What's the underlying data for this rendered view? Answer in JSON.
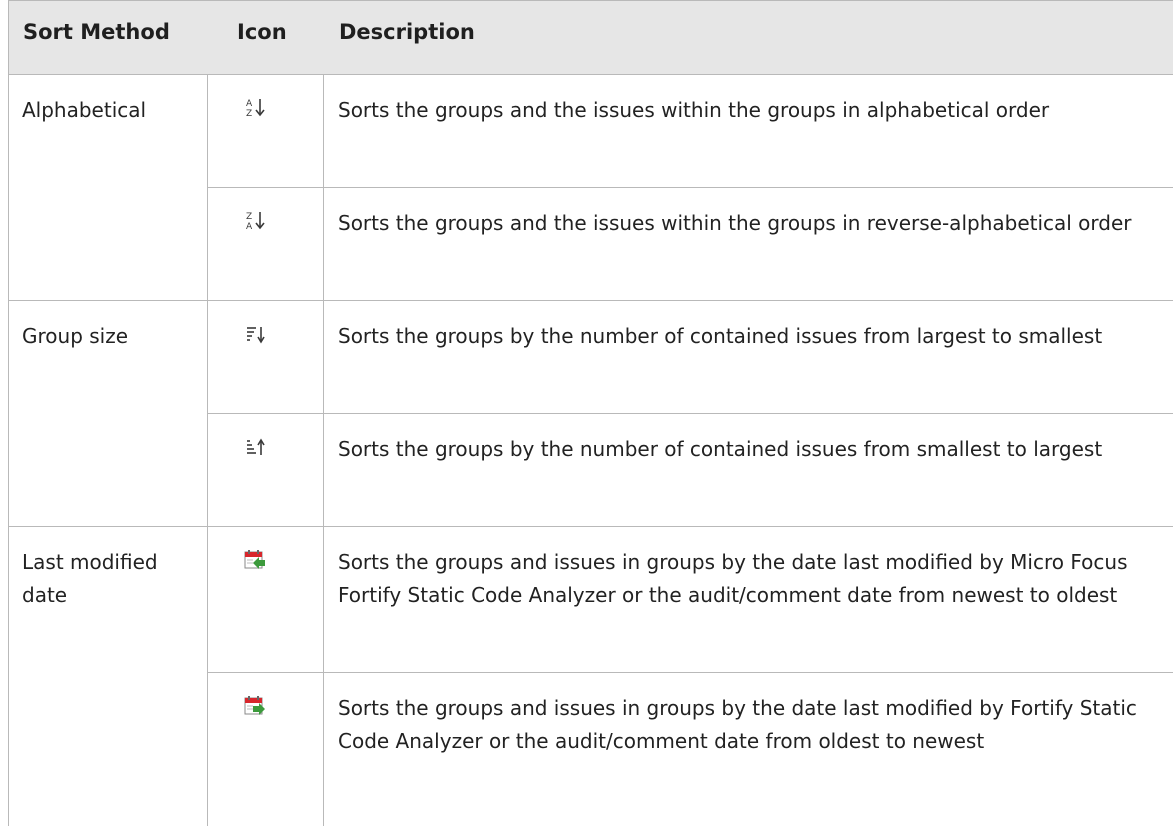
{
  "table": {
    "headers": {
      "method": "Sort Method",
      "icon": "Icon",
      "description": "Description"
    },
    "groups": [
      {
        "method": "Alphabetical",
        "rows": [
          {
            "icon": "sort-a-z-icon",
            "description": "Sorts the groups and the issues within the groups in alphabetical order"
          },
          {
            "icon": "sort-z-a-icon",
            "description": "Sorts the groups and the issues within the groups in reverse-alphabetical order"
          }
        ]
      },
      {
        "method": "Group size",
        "rows": [
          {
            "icon": "sort-size-descending-icon",
            "description": "Sorts the groups by the number of contained issues from largest to smallest"
          },
          {
            "icon": "sort-size-ascending-icon",
            "description": "Sorts the groups by the number of contained issues from smallest to largest"
          }
        ]
      },
      {
        "method": "Last modified date",
        "rows": [
          {
            "icon": "calendar-newest-first-icon",
            "description": "Sorts the groups and issues in groups by the date last modified by Micro Focus Fortify Static Code Analyzer or the audit/comment date from newest to oldest"
          },
          {
            "icon": "calendar-oldest-first-icon",
            "description": "Sorts the groups and issues in groups by the date last modified by Fortify Static Code Analyzer or the audit/comment date from oldest to newest"
          }
        ]
      }
    ]
  },
  "colors": {
    "header_bg": "#e6e6e6",
    "border": "#b9b9b9",
    "calendar_red": "#d8262c",
    "arrow_green": "#3c9a3c"
  }
}
